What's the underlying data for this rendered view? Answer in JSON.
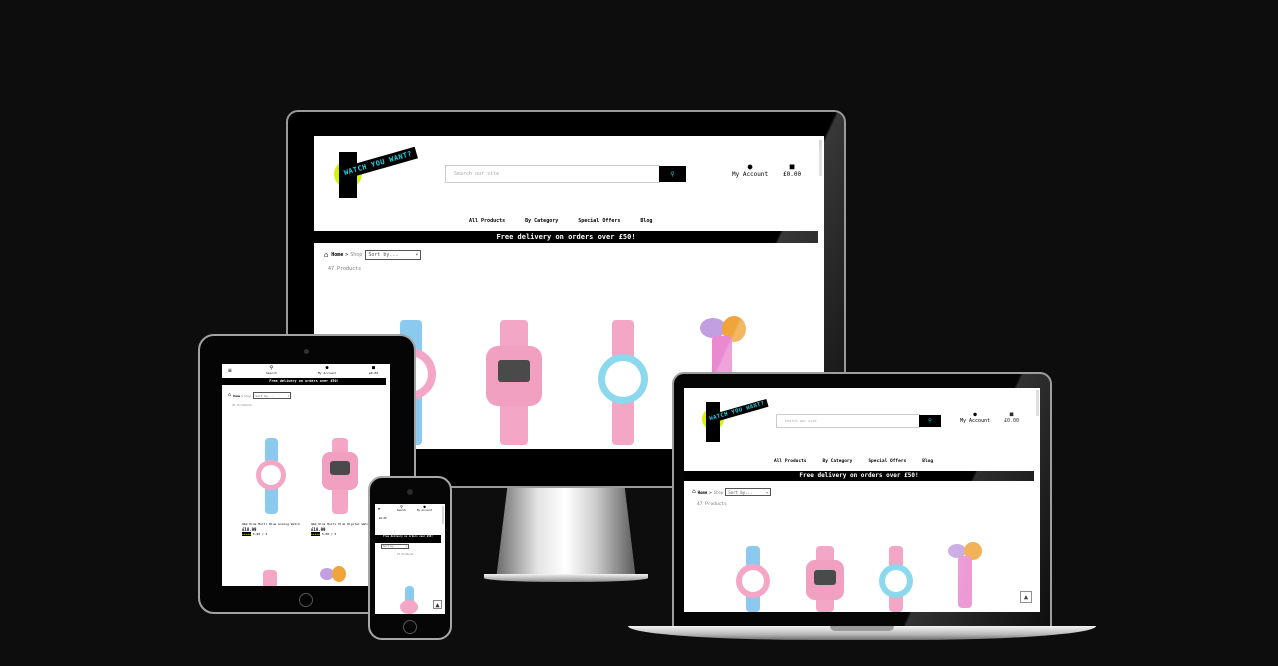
{
  "site": {
    "logo_text": "WATCH YOU WANT?",
    "search_placeholder": "Search our site",
    "account_label": "My Account",
    "basket_total": "£0.00",
    "search_label": "Search",
    "nav": [
      "All Products",
      "By Category",
      "Special Offers",
      "Blog"
    ],
    "banner": "Free delivery on orders over £50!",
    "breadcrumb_home": "Home",
    "breadcrumb_sep": ">",
    "breadcrumb_current": "Shop",
    "sort_label": "Sort by...",
    "product_count": "47 Products"
  },
  "products": [
    {
      "name": "Q&Q Kids Multi Blue Analog Watch",
      "price": "£18.99",
      "rating": "5.00 / 5"
    },
    {
      "name": "Q&Q Kids Multi Pink Digital Watch",
      "price": "£18.99",
      "rating": "5.00 / 5"
    }
  ],
  "colors": {
    "logo_yellow": "#d8f20a",
    "logo_cyan": "#22d3e6",
    "strap_blue": "#8cc9ee",
    "strap_pink": "#f4a6c6",
    "background": "#0e0d0d"
  },
  "icons": {
    "search": "magnifier-icon",
    "account": "user-icon",
    "basket": "basket-icon",
    "home": "home-icon",
    "menu": "hamburger-icon",
    "up": "arrow-up-icon"
  }
}
